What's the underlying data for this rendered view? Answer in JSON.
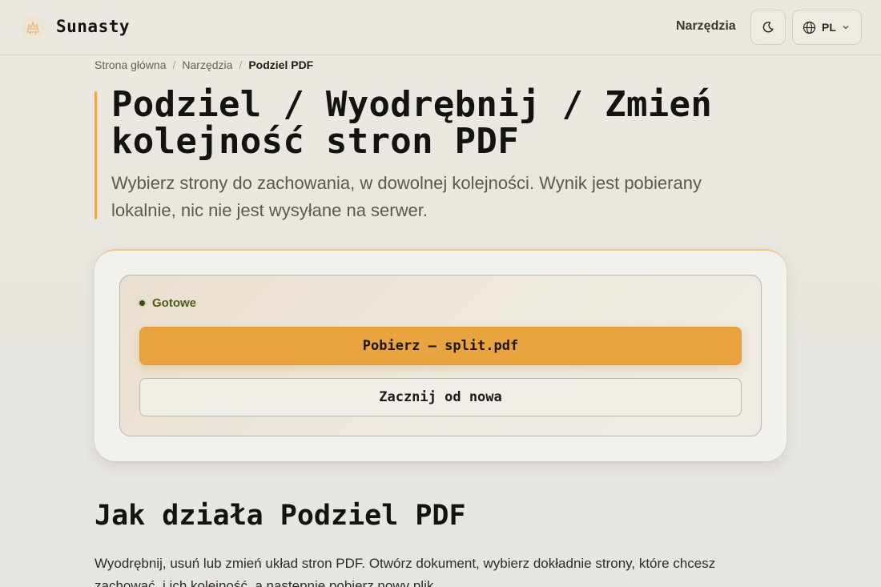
{
  "header": {
    "brand": "Sunasty",
    "nav_tools": "Narzędzia",
    "language": "PL"
  },
  "breadcrumb": {
    "home": "Strona główna",
    "tools": "Narzędzia",
    "current": "Podziel PDF",
    "separator": "/"
  },
  "hero": {
    "title": "Podziel / Wyodrębnij / Zmień kolejność stron PDF",
    "subtitle": "Wybierz strony do zachowania, w dowolnej kolejności. Wynik jest pobierany lokalnie, nic nie jest wysyłane na serwer."
  },
  "result": {
    "status": "Gotowe",
    "download_label": "Pobierz — split.pdf",
    "reset_label": "Zacznij od nowa"
  },
  "section": {
    "title": "Jak działa Podziel PDF",
    "text": "Wyodrębnij, usuń lub zmień układ stron PDF. Otwórz dokument, wybierz dokładnie strony, które chcesz zachować, i ich kolejność, a następnie pobierz nowy plik."
  },
  "icons": {
    "logo": "sun-logo-icon",
    "theme": "moon-icon",
    "language": "globe-icon",
    "dropdown": "chevron-down-icon"
  },
  "colors": {
    "accent": "#e9a43f",
    "status": "#4f5d14",
    "background": "#e9e6e0"
  }
}
